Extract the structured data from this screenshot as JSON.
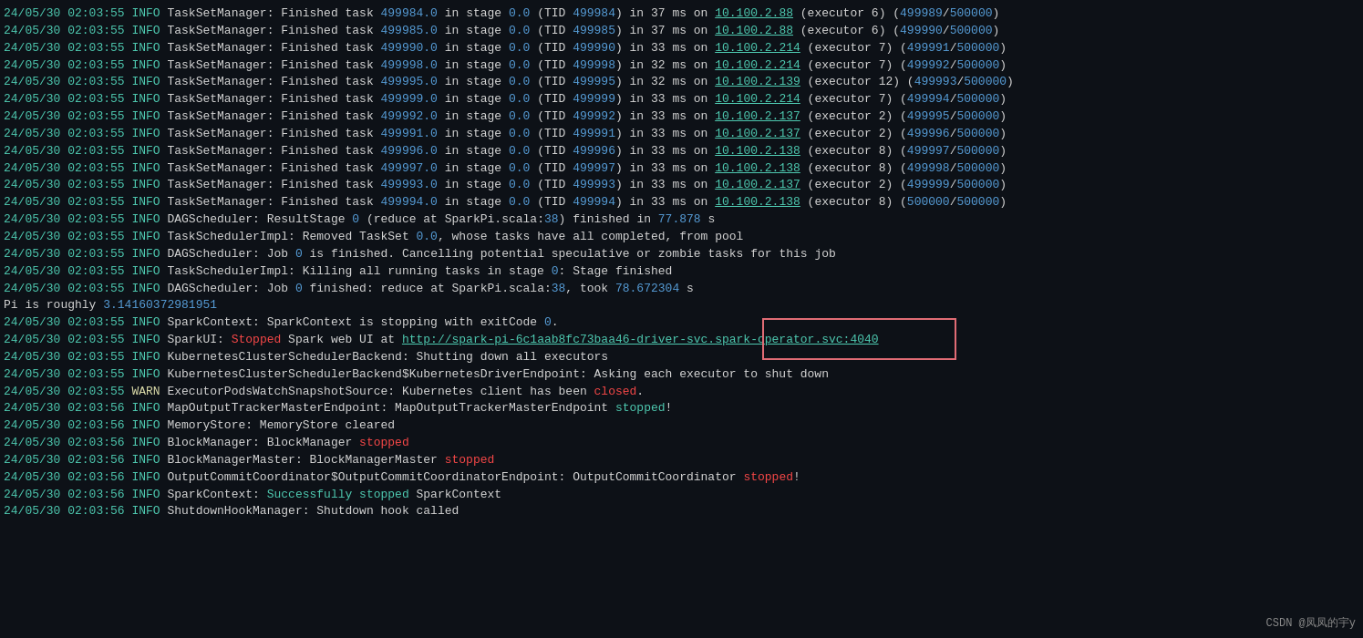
{
  "lines": [
    {
      "ts": "24/05/30 02:03:55",
      "level": "INFO",
      "msg": "TaskSetManager: Finished task ",
      "num1": "499984.0",
      "mid1": " in stage ",
      "num2": "0.0",
      "mid2": " (TID ",
      "num3": "499984",
      "mid3": ") in 37 ms on ",
      "link": "10.100.2.88",
      "end": " (executor 6) (",
      "num4": "499989",
      "slash": "/",
      "num5": "500000",
      "close": ")"
    }
  ],
  "watermark": "CSDN @凤凤的宇y"
}
